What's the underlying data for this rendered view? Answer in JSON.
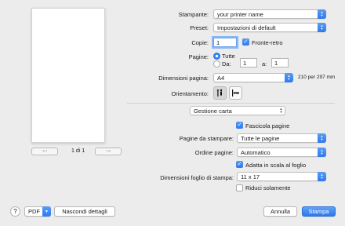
{
  "preview": {
    "page_indicator": "1 di 1",
    "first_prev_glyph": "«  ‹",
    "next_last_glyph": "›  »"
  },
  "printer": {
    "label": "Stampante:",
    "value": "your printer name"
  },
  "preset": {
    "label": "Preset:",
    "value": "Impostazioni di default"
  },
  "copies": {
    "label": "Copie:",
    "value": "1",
    "duplex_label": "Fronte-retro",
    "duplex_checked": true
  },
  "pages": {
    "label": "Pagine:",
    "all_label": "Tutte",
    "range_label": "Da:",
    "from_value": "1",
    "to_label": "a:",
    "to_value": "1",
    "selected": "all"
  },
  "page_size": {
    "label": "Dimensioni pagina:",
    "value": "A4",
    "detail": "210 per 297 mm"
  },
  "orientation": {
    "label": "Orientamento:",
    "selected": "portrait"
  },
  "section": {
    "value": "Gestione carta"
  },
  "collate": {
    "label": "Fascicola pagine",
    "checked": true
  },
  "pages_to_print": {
    "label": "Pagine da stampare:",
    "value": "Tutte le pagine"
  },
  "page_order": {
    "label": "Ordine pagine:",
    "value": "Automatico"
  },
  "scale_to_fit": {
    "label": "Adatta in scala al foglio",
    "checked": true
  },
  "dest_paper_size": {
    "label": "Dimensioni foglio di stampa:",
    "value": "11 x 17"
  },
  "scale_down_only": {
    "label": "Riduci solamente",
    "checked": false
  },
  "footer": {
    "help_glyph": "?",
    "pdf_label": "PDF",
    "hide_details_label": "Nascondi dettagli",
    "cancel_label": "Annulla",
    "print_label": "Stampa"
  },
  "colors": {
    "accent": "#2f79ec",
    "background": "#ececec"
  }
}
